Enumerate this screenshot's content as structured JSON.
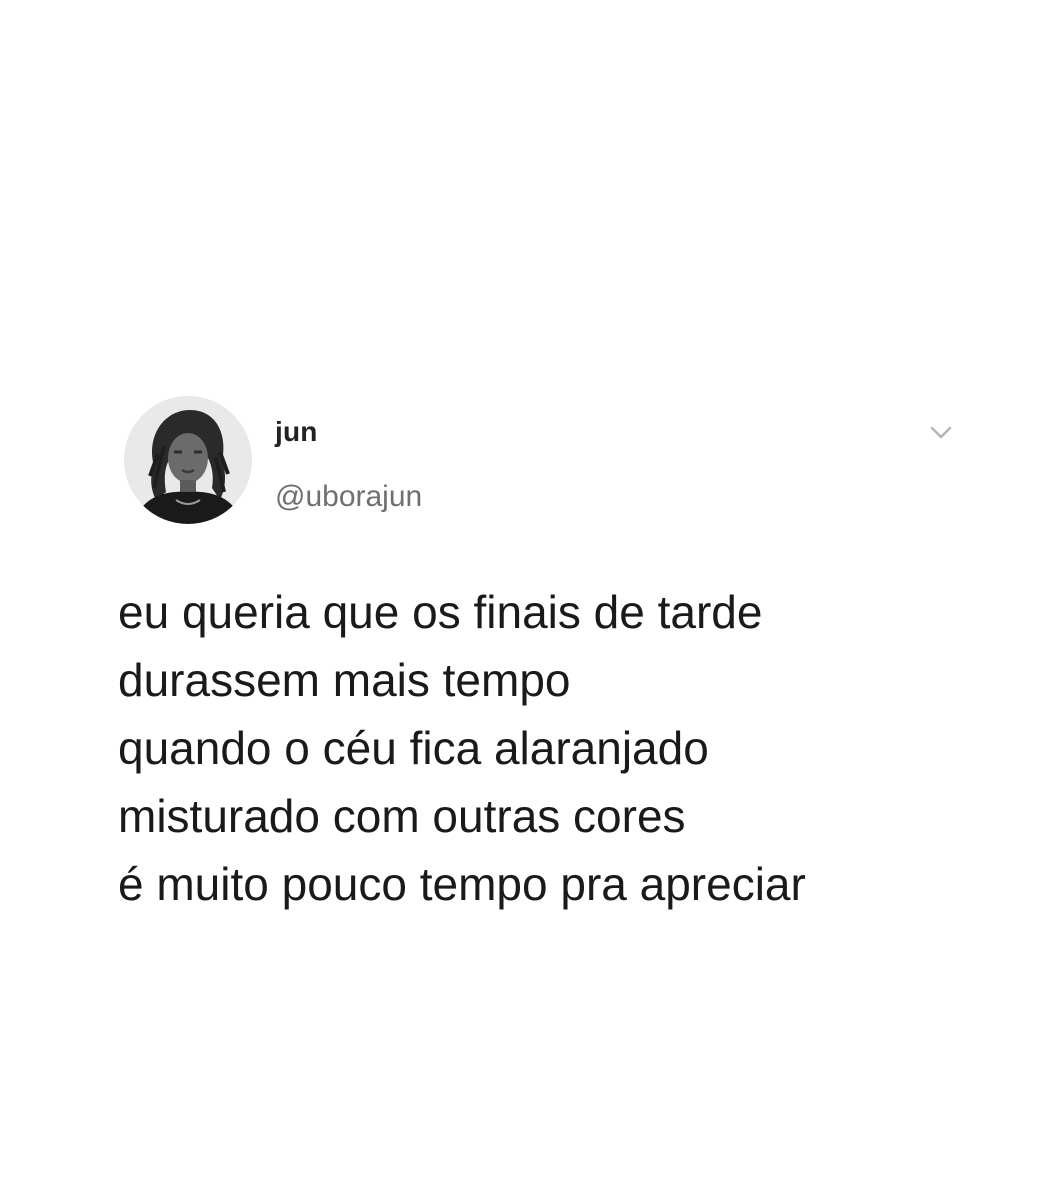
{
  "tweet": {
    "author": {
      "display_name": "jun",
      "handle": "@uborajun",
      "avatar_icon": "profile-photo"
    },
    "menu_icon": "chevron-down-icon",
    "lines": [
      "eu queria que os finais de tarde",
      "durassem mais tempo",
      "quando o céu fica alaranjado",
      "misturado com outras cores",
      "é muito pouco tempo pra apreciar"
    ]
  },
  "colors": {
    "background": "#ffffff",
    "text": "#1a1a1a",
    "handle": "#6f6f6f",
    "chevron": "#b5b5b5"
  }
}
